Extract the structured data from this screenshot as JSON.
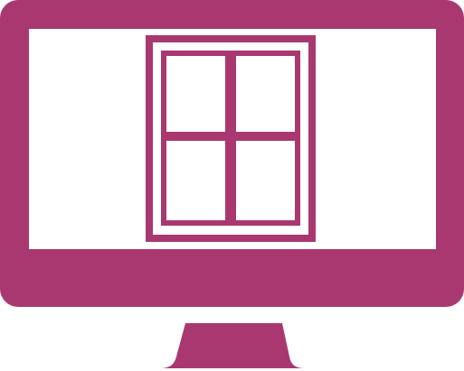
{
  "illustration": {
    "subject": "computer-monitor-with-window-icon",
    "colors": {
      "primary": "#aa3870",
      "screen": "#ffffff",
      "background": "#ffffff"
    },
    "icons": [
      "monitor-icon",
      "window-icon"
    ],
    "window_panes": 4
  }
}
